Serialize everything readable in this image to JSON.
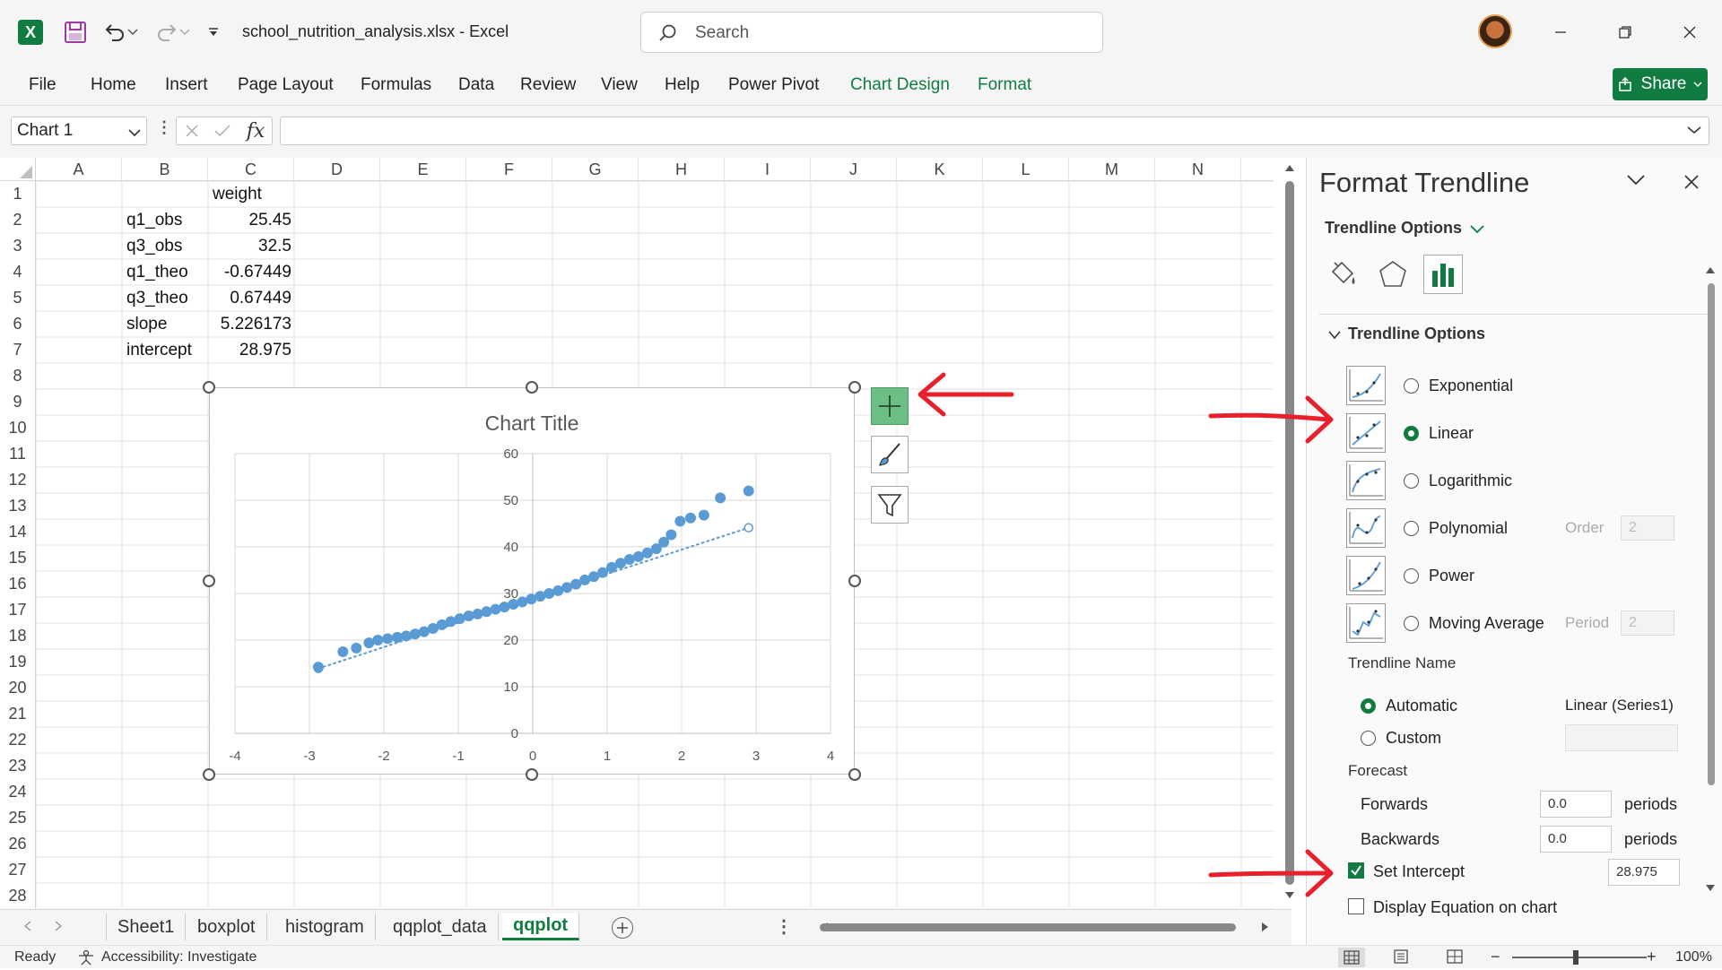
{
  "app": {
    "file_name": "school_nutrition_analysis.xlsx",
    "separator": "-",
    "app_name": "Excel",
    "search_placeholder": "Search"
  },
  "ribbon": {
    "tabs": [
      "File",
      "Home",
      "Insert",
      "Page Layout",
      "Formulas",
      "Data",
      "Review",
      "View",
      "Help",
      "Power Pivot",
      "Chart Design",
      "Format"
    ],
    "share_label": "Share"
  },
  "formula_bar": {
    "name_box": "Chart 1",
    "fx": "fx",
    "formula": ""
  },
  "grid": {
    "columns": [
      "A",
      "B",
      "C",
      "D",
      "E",
      "F",
      "G",
      "H",
      "I",
      "J",
      "K",
      "L",
      "M",
      "N"
    ],
    "rows": [
      "1",
      "2",
      "3",
      "4",
      "5",
      "6",
      "7",
      "8",
      "9",
      "10",
      "11",
      "12",
      "13",
      "14",
      "15",
      "16",
      "17",
      "18",
      "19",
      "20",
      "21",
      "22",
      "23",
      "24",
      "25",
      "26",
      "27",
      "28"
    ],
    "cells": {
      "C1": "weight",
      "B2": "q1_obs",
      "C2": "25.45",
      "B3": "q3_obs",
      "C3": "32.5",
      "B4": "q1_theo",
      "C4": "-0.67449",
      "B5": "q3_theo",
      "C5": "0.67449",
      "B6": "slope",
      "C6": "5.226173",
      "B7": "intercept",
      "C7": "28.975"
    }
  },
  "chart_data": {
    "type": "scatter",
    "title": "Chart Title",
    "xlim": [
      -4,
      4
    ],
    "ylim": [
      0,
      60
    ],
    "x_ticks": [
      "-4",
      "-3",
      "-2",
      "-1",
      "0",
      "1",
      "2",
      "3",
      "4"
    ],
    "y_ticks": [
      "0",
      "10",
      "20",
      "30",
      "40",
      "50",
      "60"
    ],
    "grid": true,
    "series": [
      {
        "color": "#5b9bd5",
        "points": [
          [
            -2.88,
            14.2
          ],
          [
            -2.55,
            17.5
          ],
          [
            -2.37,
            18.3
          ],
          [
            -2.2,
            19.4
          ],
          [
            -2.08,
            20.0
          ],
          [
            -1.95,
            20.3
          ],
          [
            -1.82,
            20.6
          ],
          [
            -1.7,
            20.9
          ],
          [
            -1.58,
            21.3
          ],
          [
            -1.46,
            21.8
          ],
          [
            -1.34,
            22.5
          ],
          [
            -1.22,
            23.3
          ],
          [
            -1.1,
            24.0
          ],
          [
            -0.98,
            24.6
          ],
          [
            -0.86,
            25.2
          ],
          [
            -0.74,
            25.6
          ],
          [
            -0.62,
            26.1
          ],
          [
            -0.5,
            26.6
          ],
          [
            -0.38,
            27.1
          ],
          [
            -0.26,
            27.7
          ],
          [
            -0.14,
            28.2
          ],
          [
            -0.02,
            28.8
          ],
          [
            0.1,
            29.4
          ],
          [
            0.22,
            30.0
          ],
          [
            0.34,
            30.6
          ],
          [
            0.46,
            31.3
          ],
          [
            0.58,
            32.0
          ],
          [
            0.7,
            32.9
          ],
          [
            0.82,
            33.6
          ],
          [
            0.94,
            34.5
          ],
          [
            1.06,
            35.6
          ],
          [
            1.18,
            36.5
          ],
          [
            1.3,
            37.3
          ],
          [
            1.42,
            37.9
          ],
          [
            1.54,
            38.7
          ],
          [
            1.66,
            39.6
          ],
          [
            1.76,
            41.0
          ],
          [
            1.86,
            42.6
          ],
          [
            1.98,
            45.5
          ],
          [
            2.12,
            46.2
          ],
          [
            2.3,
            46.8
          ],
          [
            2.52,
            50.5
          ],
          [
            2.9,
            52.0
          ]
        ]
      },
      {
        "name": "Linear (Series1)",
        "color": "#5b9bd5",
        "style": "dotted",
        "x": [
          -2.88,
          2.9
        ],
        "y": [
          13.9,
          44.1
        ]
      }
    ]
  },
  "sheets": {
    "tabs": [
      "Sheet1",
      "boxplot",
      "histogram",
      "qqplot_data",
      "qqplot"
    ],
    "active": "qqplot"
  },
  "status": {
    "ready": "Ready",
    "accessibility": "Accessibility: Investigate",
    "zoom": "100%"
  },
  "pane": {
    "title": "Format Trendline",
    "subtitle": "Trendline Options",
    "section": "Trendline Options",
    "types": [
      {
        "label": "Exponential",
        "selected": false
      },
      {
        "label": "Linear",
        "selected": true
      },
      {
        "label": "Logarithmic",
        "selected": false
      },
      {
        "label": "Polynomial",
        "selected": false,
        "sub_label": "Order",
        "sub_value": "2"
      },
      {
        "label": "Power",
        "selected": false
      },
      {
        "label": "Moving Average",
        "selected": false,
        "sub_label": "Period",
        "sub_value": "2"
      }
    ],
    "name_label": "Trendline Name",
    "automatic_label": "Automatic",
    "automatic_value": "Linear (Series1)",
    "custom_label": "Custom",
    "forecast_label": "Forecast",
    "forwards_label": "Forwards",
    "forwards_value": "0.0",
    "backwards_label": "Backwards",
    "backwards_value": "0.0",
    "periods_label": "periods",
    "set_intercept_label": "Set Intercept",
    "set_intercept_value": "28.975",
    "display_equation_label": "Display Equation on chart"
  },
  "colors": {
    "excel_green": "#107c41",
    "series": "#5b9bd5",
    "annotation_red": "#e8202c"
  }
}
